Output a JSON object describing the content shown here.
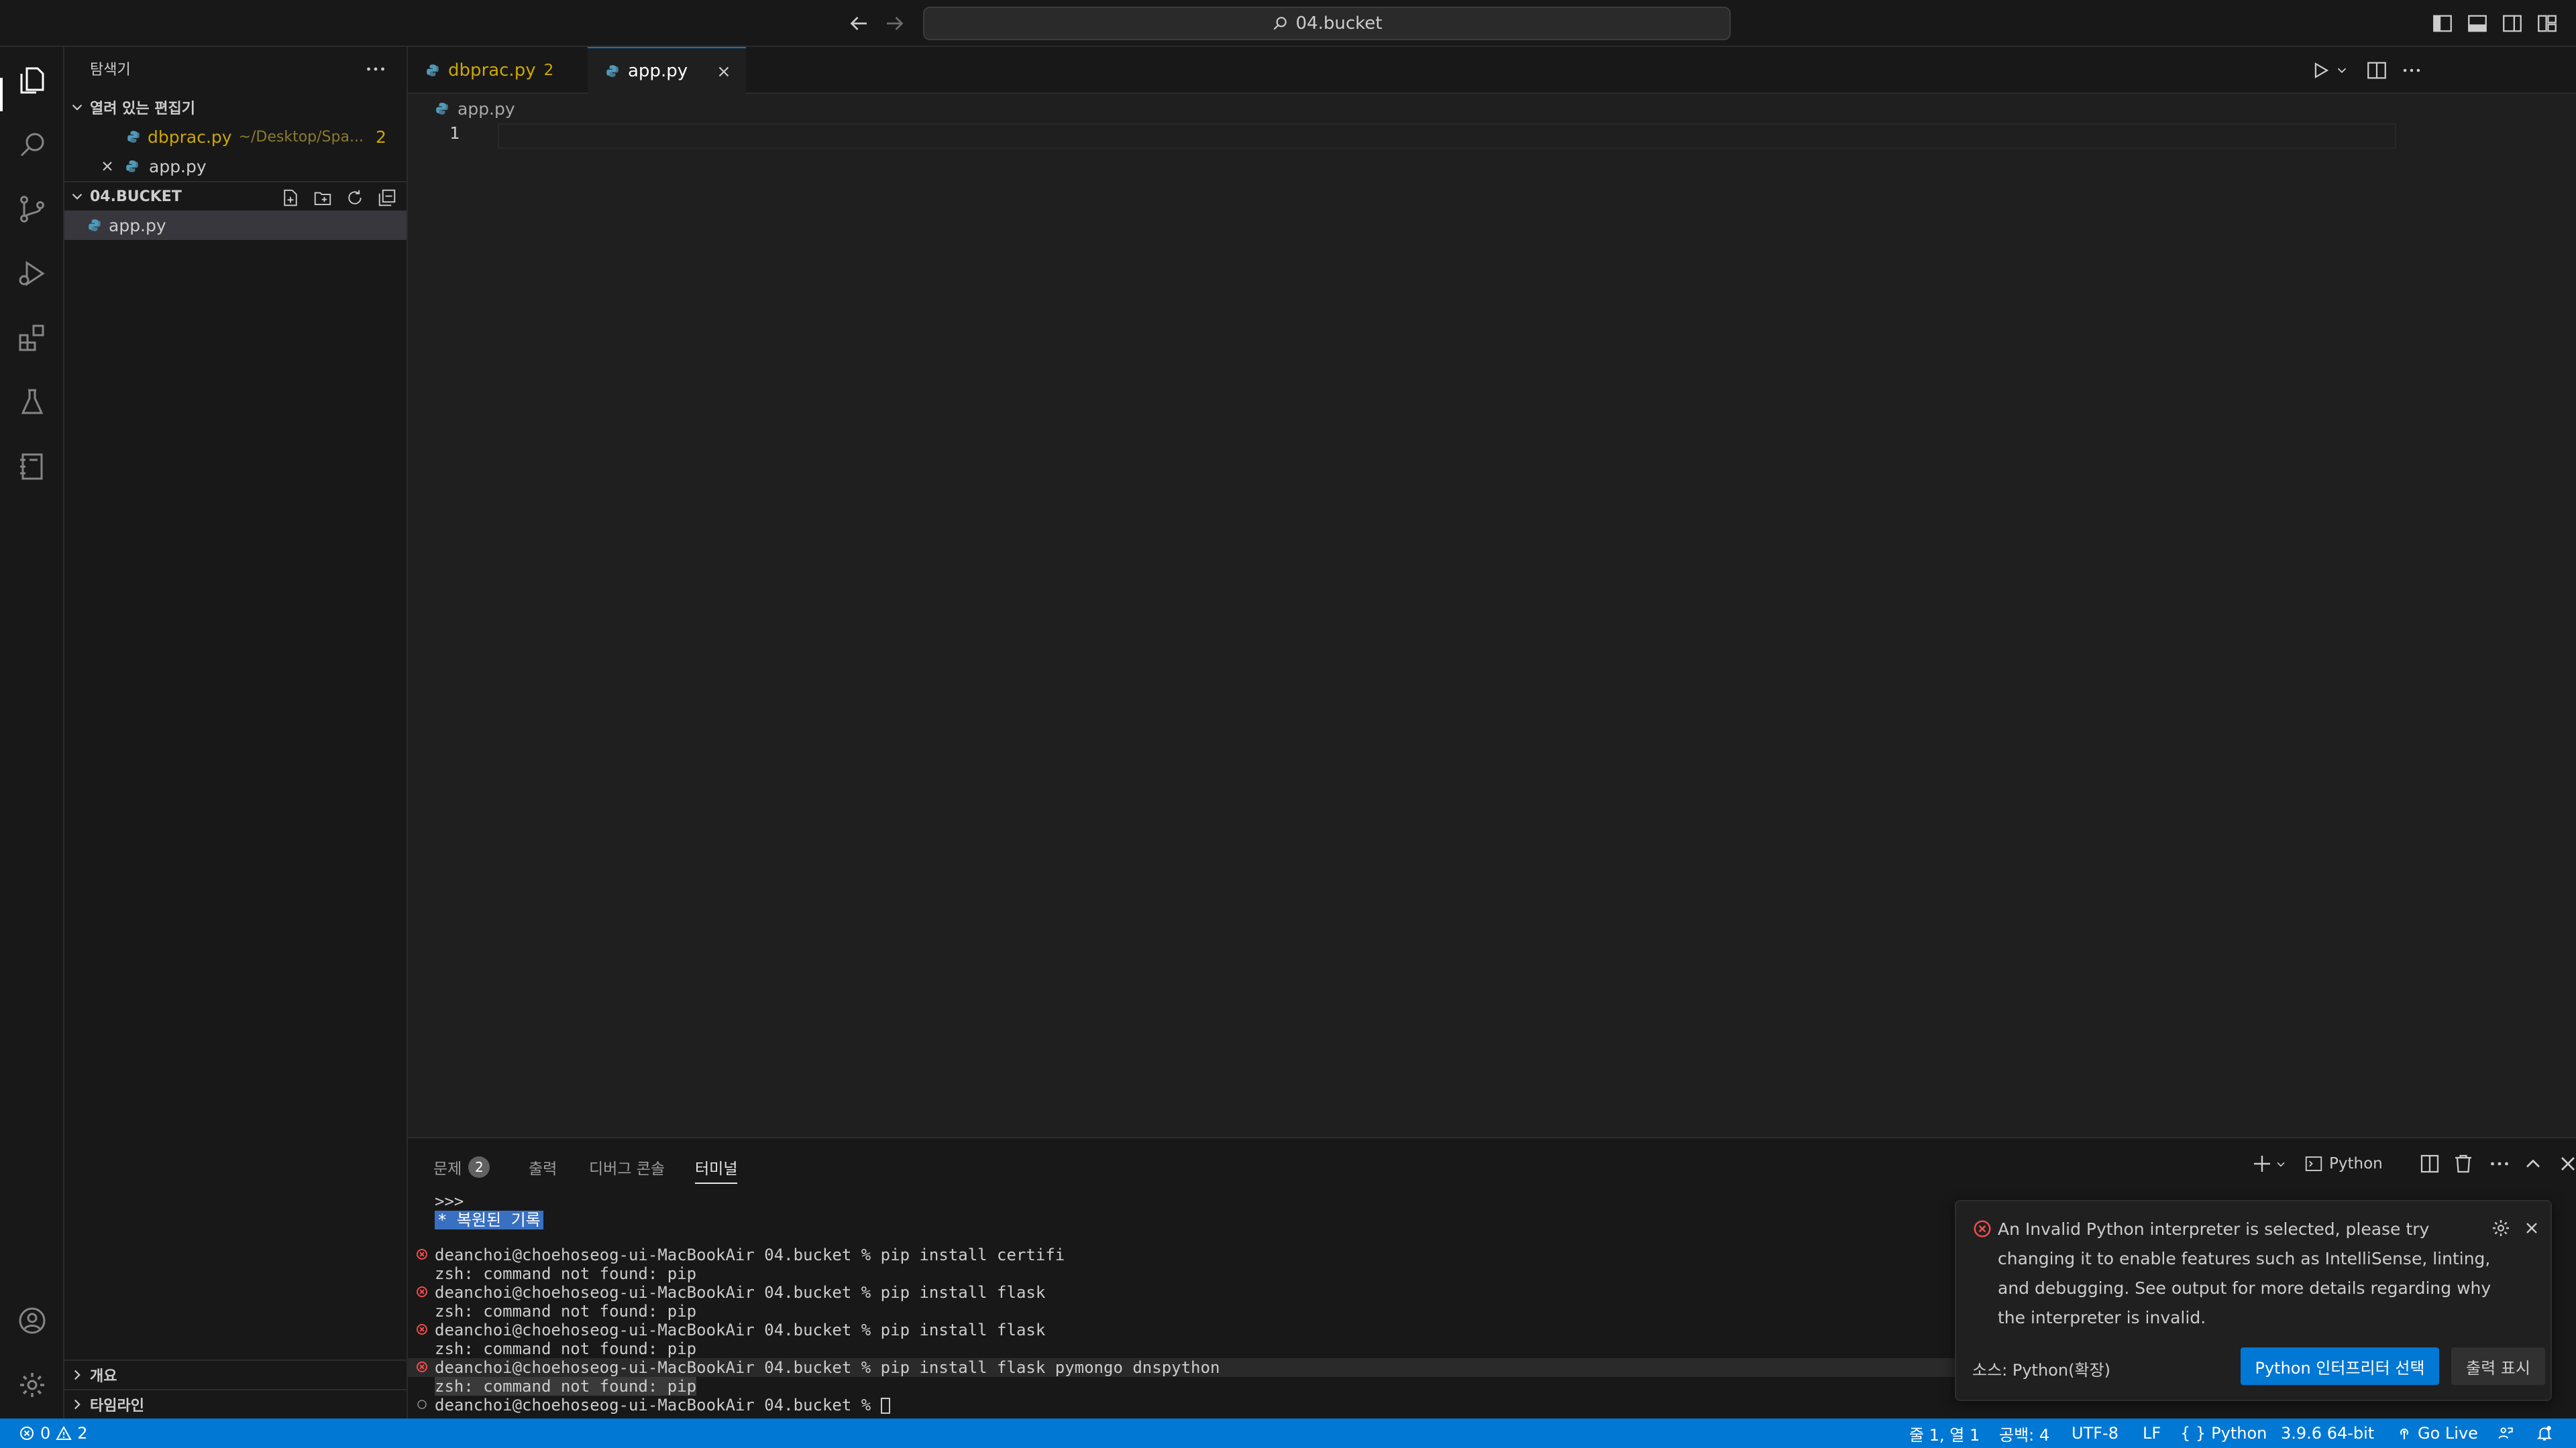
{
  "titlebar": {
    "search_text": "04.bucket"
  },
  "sidebar": {
    "title": "탐색기",
    "open_editors": {
      "label": "열려 있는 편집기",
      "items": [
        {
          "name": "dbprac.py",
          "path": "~/Desktop/Spa...",
          "badge": "2"
        },
        {
          "name": "app.py"
        }
      ]
    },
    "folder": {
      "label": "04.BUCKET",
      "files": [
        {
          "name": "app.py"
        }
      ]
    },
    "outline_label": "개요",
    "timeline_label": "타임라인"
  },
  "tabs": [
    {
      "label": "dbprac.py",
      "badge": "2"
    },
    {
      "label": "app.py"
    }
  ],
  "editor": {
    "breadcrumb": "app.py",
    "line_number": "1"
  },
  "panel": {
    "tabs": [
      {
        "label": "문제",
        "badge": "2"
      },
      {
        "label": "출력"
      },
      {
        "label": "디버그 콘솔"
      },
      {
        "label": "터미널"
      }
    ],
    "shell_label": "Python",
    "terminal_lines": [
      ">>>",
      "* 복원된 기록",
      "deanchoi@choehoseog-ui-MacBookAir 04.bucket % pip install certifi",
      "zsh: command not found: pip",
      "deanchoi@choehoseog-ui-MacBookAir 04.bucket % pip install flask",
      "zsh: command not found: pip",
      "deanchoi@choehoseog-ui-MacBookAir 04.bucket % pip install flask",
      "zsh: command not found: pip",
      "deanchoi@choehoseog-ui-MacBookAir 04.bucket % pip install flask pymongo dnspython",
      "zsh: command not found: pip",
      "deanchoi@choehoseog-ui-MacBookAir 04.bucket % "
    ]
  },
  "notification": {
    "message": "An Invalid Python interpreter is selected, please try changing it to enable features such as IntelliSense, linting, and debugging. See output for more details regarding why the interpreter is invalid.",
    "source": "소스: Python(확장)",
    "primary_button": "Python 인터프리터 선택",
    "secondary_button": "출력 표시"
  },
  "statusbar": {
    "errors": "0",
    "warnings": "2",
    "position": "줄 1, 열 1",
    "indent": "공백: 4",
    "encoding": "UTF-8",
    "eol": "LF",
    "language": "Python",
    "interpreter": "3.9.6 64-bit",
    "golive": "Go Live"
  },
  "colors": {
    "accent": "#0078d4",
    "error": "#f14c4c",
    "warning_text": "#cca700",
    "python_icon": "#519aba"
  }
}
